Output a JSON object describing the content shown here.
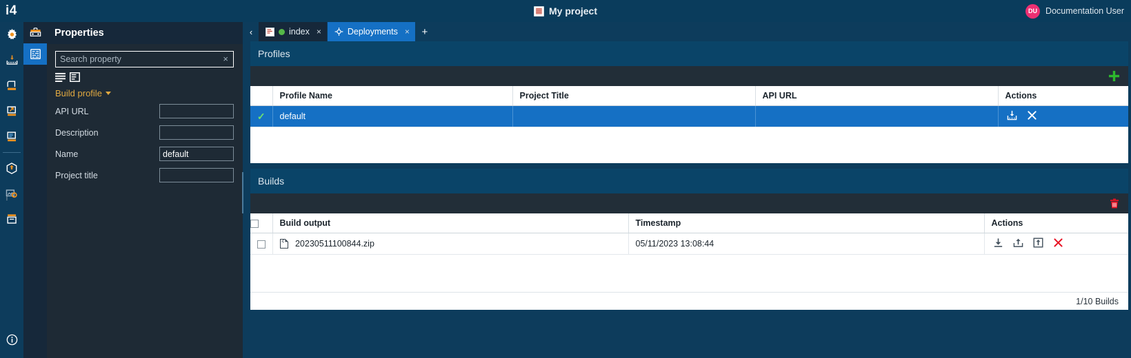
{
  "topbar": {
    "logo": "i4",
    "project_icon": "project-icon",
    "project_title": "My project",
    "user_initials": "DU",
    "user_name": "Documentation User"
  },
  "rail": {
    "items": [
      {
        "name": "settings-gear-icon",
        "label": "Settings"
      },
      {
        "name": "measurements-icon",
        "label": "Measurements"
      },
      {
        "name": "storage-icon",
        "label": "Storage"
      },
      {
        "name": "export-icon",
        "label": "Export"
      },
      {
        "name": "reports-icon",
        "label": "Reports"
      },
      {
        "name": "deploy-package-icon",
        "label": "Deploy"
      },
      {
        "name": "image-settings-icon",
        "label": "Image settings"
      },
      {
        "name": "archive-icon",
        "label": "Archive"
      }
    ],
    "info": {
      "name": "info-icon",
      "label": "Info"
    }
  },
  "rail2": {
    "items": [
      {
        "name": "toolbox-icon",
        "label": "Toolbox",
        "active": false
      },
      {
        "name": "properties-icon",
        "label": "Properties",
        "active": true
      }
    ]
  },
  "properties": {
    "title": "Properties",
    "search": {
      "placeholder": "Search property",
      "value": "",
      "clear": "×"
    },
    "view_toggles": [
      {
        "name": "list-view-icon",
        "label": "Flat list"
      },
      {
        "name": "grouped-view-icon",
        "label": "Grouped"
      }
    ],
    "group": {
      "label": "Build profile",
      "expanded": true
    },
    "fields": [
      {
        "label": "API URL",
        "value": ""
      },
      {
        "label": "Description",
        "value": ""
      },
      {
        "label": "Name",
        "value": "default"
      },
      {
        "label": "Project title",
        "value": ""
      }
    ]
  },
  "tabs": {
    "prev_label": "‹",
    "add_label": "+",
    "items": [
      {
        "label": "index",
        "icon": "page-icon",
        "status_dot": "#55b848",
        "active": false,
        "close": "×"
      },
      {
        "label": "Deployments",
        "icon": "deployments-icon",
        "active": true,
        "close": "×"
      }
    ]
  },
  "profiles_panel": {
    "title": "Profiles",
    "toolbar": [
      {
        "name": "add-profile-icon",
        "label": "+",
        "color": "#2db82d"
      }
    ],
    "columns": [
      "",
      "Profile Name",
      "Project Title",
      "API URL",
      "Actions"
    ],
    "rows": [
      {
        "selected": true,
        "check": "✓",
        "profile_name": "default",
        "project_title": "",
        "api_url": "",
        "actions": [
          {
            "name": "save-profile-icon",
            "label": "Save"
          },
          {
            "name": "delete-profile-icon",
            "label": "Delete"
          }
        ]
      }
    ]
  },
  "builds_panel": {
    "title": "Builds",
    "toolbar": [
      {
        "name": "delete-builds-icon",
        "label": "Delete",
        "color": "#e81123"
      }
    ],
    "columns": [
      "",
      "Build output",
      "Timestamp",
      "Actions"
    ],
    "rows": [
      {
        "selected": false,
        "checked": false,
        "file_icon": "zip-file-icon",
        "build_output": "20230511100844.zip",
        "timestamp": "05/11/2023 13:08:44",
        "actions": [
          {
            "name": "download-build-icon",
            "label": "Download"
          },
          {
            "name": "deploy-build-icon",
            "label": "Deploy"
          },
          {
            "name": "upload-build-icon",
            "label": "Upload"
          },
          {
            "name": "delete-build-icon",
            "label": "Delete"
          }
        ]
      }
    ],
    "footer": "1/10 Builds"
  }
}
